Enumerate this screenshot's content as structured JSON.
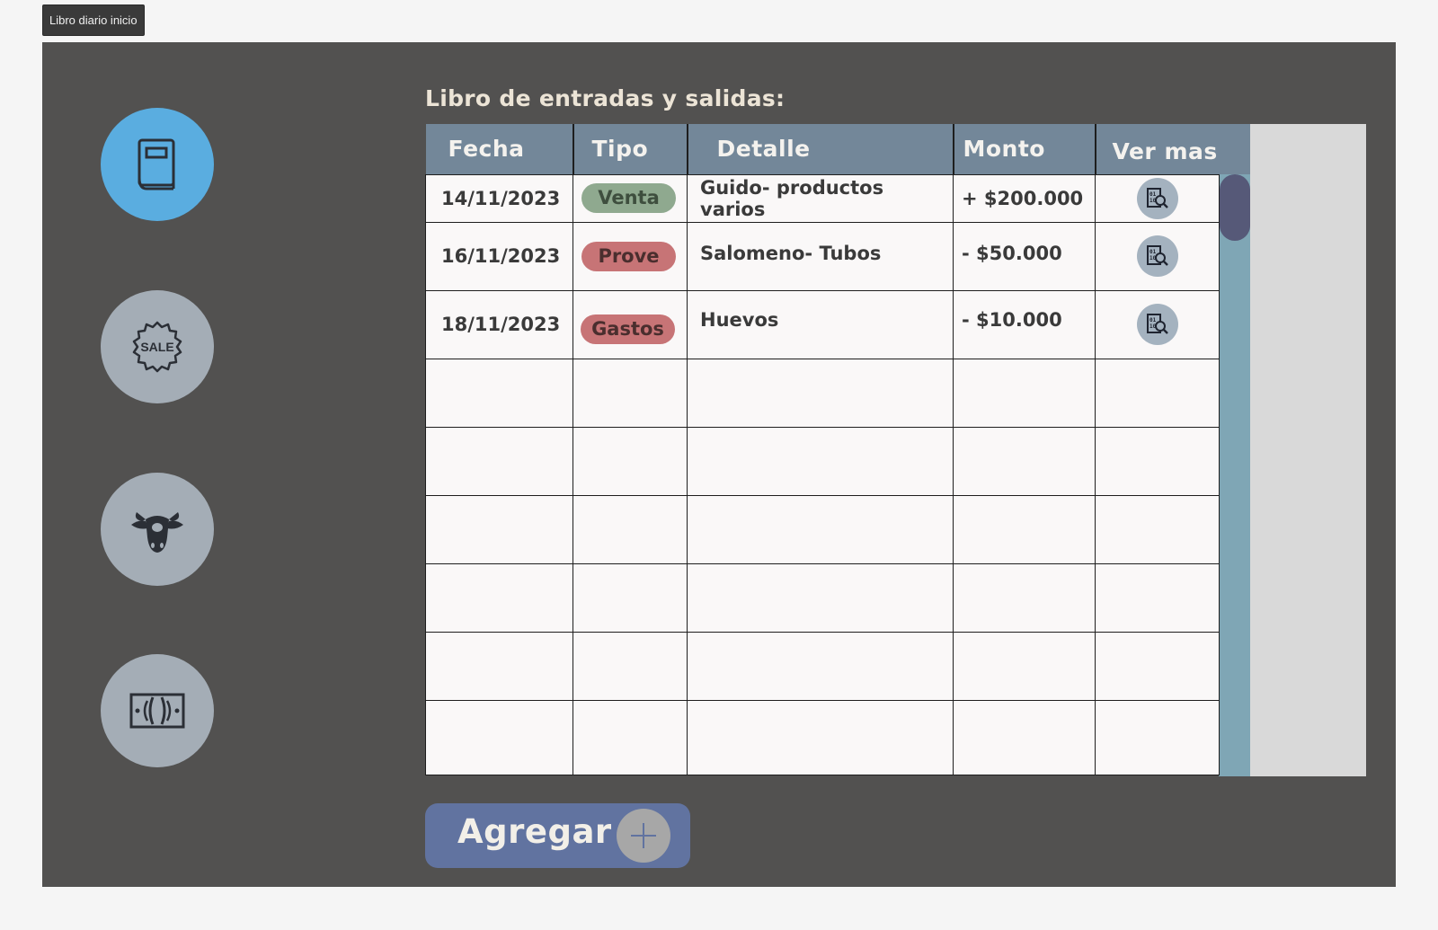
{
  "window": {
    "tab_title": "Libro diario inicio"
  },
  "sidebar": {
    "items": [
      {
        "icon": "book-icon",
        "active": true
      },
      {
        "icon": "sale-badge-icon",
        "active": false
      },
      {
        "icon": "cow-icon",
        "active": false
      },
      {
        "icon": "money-icon",
        "active": false
      }
    ]
  },
  "main": {
    "title": "Libro de entradas y salidas:",
    "columns": [
      "Fecha",
      "Tipo",
      "Detalle",
      "Monto",
      "Ver mas"
    ],
    "rows": [
      {
        "fecha": "14/11/2023",
        "tipo": "Venta",
        "detalle": "Guido- productos varios",
        "monto": "+ $200.000"
      },
      {
        "fecha": "16/11/2023",
        "tipo": "Prove",
        "detalle": "Salomeno- Tubos",
        "monto": "- $50.000"
      },
      {
        "fecha": "18/11/2023",
        "tipo": "Gastos",
        "detalle": "Huevos",
        "monto": "- $10.000"
      }
    ],
    "add_button_label": "Agregar"
  },
  "colors": {
    "background": "#525150",
    "header": "#738799",
    "active_nav": "#5aade0",
    "inactive_nav": "#a4adb6",
    "venta": "#8fa98f",
    "prove": "#c77476",
    "gastos": "#c77476",
    "add_button": "#6173a0",
    "scroll_thumb": "#565978"
  }
}
